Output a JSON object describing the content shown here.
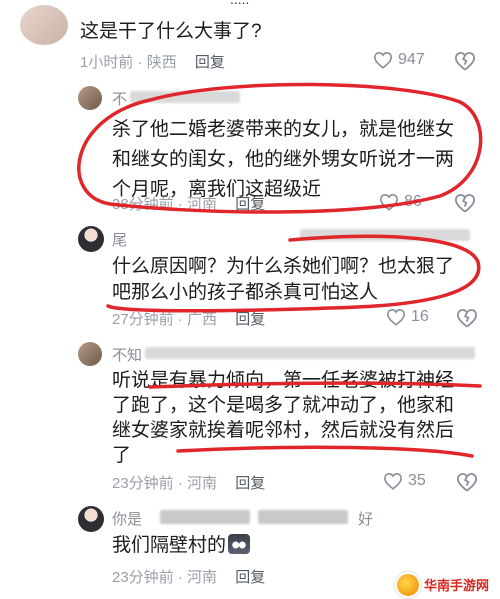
{
  "comments": [
    {
      "text": "这是干了什么大事了?",
      "time": "1小时前",
      "location": "陕西",
      "reply_label": "回复",
      "likes": "947"
    },
    {
      "username": "不",
      "text_line1": "杀了他二婚老婆带来的女儿，就是他继女",
      "text_line2": "和继女的闺女，他的继外甥女听说才一两",
      "text_line3": "个月呢，离我们这超级近",
      "time": "38分钟前",
      "location": "河南",
      "reply_label": "回复",
      "likes": "86"
    },
    {
      "username": "尾",
      "text_line1": "什么原因啊？为什么杀她们啊？也太狠了",
      "text_line2": "吧那么小的孩子都杀真可怕这人",
      "time": "27分钟前",
      "location": "广西",
      "reply_label": "回复",
      "likes": "16"
    },
    {
      "username": "不知",
      "text_line1": "听说是有暴力倾向，第一任老婆被打神经",
      "text_line2": "了跑了，这个是喝多了就冲动了，他家和",
      "text_line3": "继女婆家就挨着呢邻村，然后就没有然后",
      "text_line4": "了",
      "time": "23分钟前",
      "location": "河南",
      "reply_label": "回复",
      "likes": "35"
    },
    {
      "username_prefix": "你是",
      "username_suffix": "好",
      "text": "我们隔壁村的",
      "time": "23分钟前",
      "location": "河南",
      "reply_label": "回复"
    }
  ],
  "watermark": {
    "text": "华南手游网"
  },
  "colors": {
    "annotation_red": "#e0262b"
  }
}
